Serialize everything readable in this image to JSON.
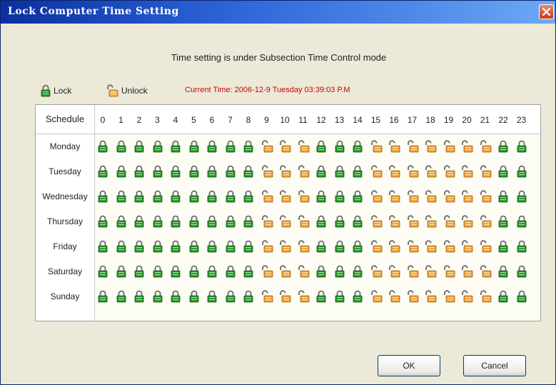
{
  "window": {
    "title": "Lock Computer Time Setting"
  },
  "mode_text": "Time setting is under Subsection Time Control mode",
  "legend": {
    "lock_label": "Lock",
    "unlock_label": "Unlock"
  },
  "current_time": "Current Time: 2006-12-9 Tuesday 03:39:03 P.M",
  "grid": {
    "header": "Schedule",
    "hours": [
      "0",
      "1",
      "2",
      "3",
      "4",
      "5",
      "6",
      "7",
      "8",
      "9",
      "10",
      "11",
      "12",
      "13",
      "14",
      "15",
      "16",
      "17",
      "18",
      "19",
      "20",
      "21",
      "22",
      "23"
    ],
    "days": [
      "Monday",
      "Tuesday",
      "Wednesday",
      "Thursday",
      "Friday",
      "Saturday",
      "Sunday"
    ],
    "schedule_states": {
      "Monday": "LLLLLLLLLUUULLLUUUUUUULL",
      "Tuesday": "LLLLLLLLLUUULLLUUUUUUULL",
      "Wednesday": "LLLLLLLLLUUULLLUUUUUUULL",
      "Thursday": "LLLLLLLLLUUULLLUUUUUUULL",
      "Friday": "LLLLLLLLLUUULLLUUUUUUULL",
      "Saturday": "LLLLLLLLLUUULLLUUUUUUULL",
      "Sunday": "LLLLLLLLLUUULLLUUUUUUULL"
    },
    "state_legend": {
      "L": "locked",
      "U": "unlocked"
    }
  },
  "buttons": {
    "ok": "OK",
    "cancel": "Cancel"
  },
  "colors": {
    "lock_green": "#2a8f2a",
    "unlock_orange": "#e8a13a",
    "current_time_red": "#cc0000",
    "titlebar_blue": "#2c63d8"
  }
}
